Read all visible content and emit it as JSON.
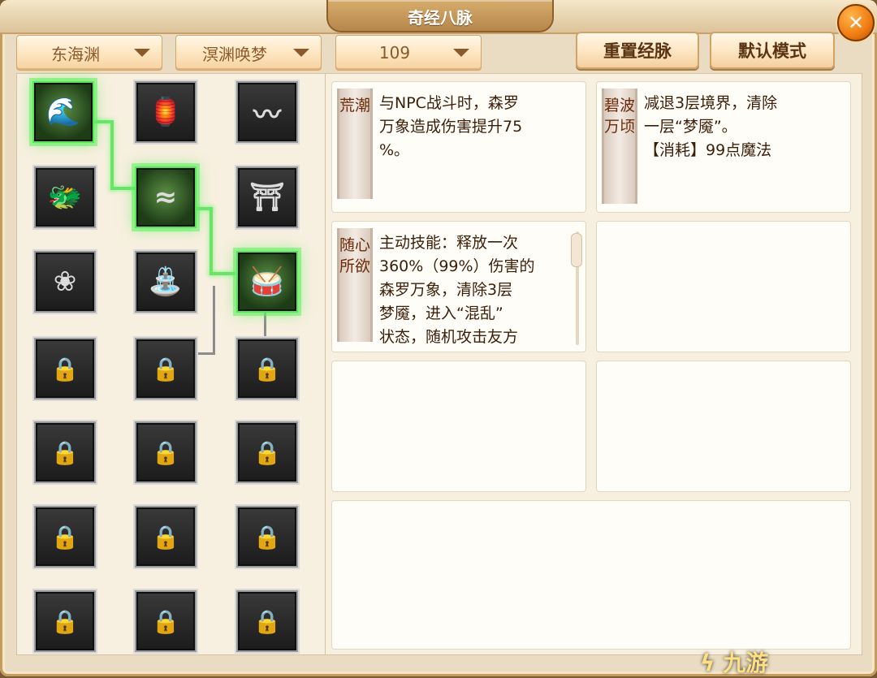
{
  "window": {
    "title": "奇经八脉",
    "close_label": "✕"
  },
  "filters": [
    {
      "id": "school",
      "value": "东海渊"
    },
    {
      "id": "path",
      "value": "溟渊唤梦"
    },
    {
      "id": "level",
      "value": "109"
    }
  ],
  "buttons": {
    "reset": "重置经脉",
    "default": "默认模式"
  },
  "cards": [
    {
      "tag": "荒潮",
      "text": "与NPC战斗时，森罗\n万象造成伤害提升75\n%。"
    },
    {
      "tag": "碧波万顷",
      "text": "减退3层境界，清除\n一层“梦魇”。\n【消耗】99点魔法"
    },
    {
      "tag": "随心所欲",
      "text": "主动技能：释放一次\n360%（99%）伤害的\n森罗万象，清除3层\n梦魇，进入“混乱”\n状态，随机攻击友方"
    }
  ],
  "icons": [
    {
      "row": 1,
      "col": 1,
      "name": "wave-spirit-icon",
      "glyph": "🌊",
      "active": true
    },
    {
      "row": 1,
      "col": 2,
      "name": "lantern-figure-icon",
      "glyph": "🏮",
      "active": false
    },
    {
      "row": 1,
      "col": 3,
      "name": "river-path-icon",
      "glyph": "〰",
      "active": false
    },
    {
      "row": 2,
      "col": 1,
      "name": "roaring-beast-icon",
      "glyph": "🐲",
      "active": false
    },
    {
      "row": 2,
      "col": 2,
      "name": "tide-wave-icon",
      "glyph": "≈",
      "active": true
    },
    {
      "row": 2,
      "col": 3,
      "name": "sea-temple-icon",
      "glyph": "⛩",
      "active": false
    },
    {
      "row": 3,
      "col": 1,
      "name": "lotus-icon",
      "glyph": "❀",
      "active": false
    },
    {
      "row": 3,
      "col": 2,
      "name": "waterfall-gate-icon",
      "glyph": "⛲",
      "active": false
    },
    {
      "row": 3,
      "col": 3,
      "name": "drum-strike-icon",
      "glyph": "🥁",
      "active": true
    },
    {
      "row": 4,
      "col": 1,
      "name": "lock-chain-icon",
      "glyph": "🔒",
      "locked": true
    },
    {
      "row": 4,
      "col": 2,
      "name": "lock-chain-icon",
      "glyph": "🔒",
      "locked": true
    },
    {
      "row": 4,
      "col": 3,
      "name": "lock-chain-icon",
      "glyph": "🔒",
      "locked": true
    },
    {
      "row": 5,
      "col": 1,
      "name": "lock-chain-icon",
      "glyph": "🔒",
      "locked": true
    },
    {
      "row": 5,
      "col": 2,
      "name": "lock-chain-icon",
      "glyph": "🔒",
      "locked": true
    },
    {
      "row": 5,
      "col": 3,
      "name": "lock-chain-icon",
      "glyph": "🔒",
      "locked": true
    },
    {
      "row": 6,
      "col": 1,
      "name": "lock-chain-icon",
      "glyph": "🔒",
      "locked": true
    },
    {
      "row": 6,
      "col": 2,
      "name": "lock-chain-icon",
      "glyph": "🔒",
      "locked": true
    },
    {
      "row": 6,
      "col": 3,
      "name": "lock-chain-icon",
      "glyph": "🔒",
      "locked": true
    },
    {
      "row": 7,
      "col": 1,
      "name": "lock-chain-icon",
      "glyph": "🔒",
      "locked": true
    },
    {
      "row": 7,
      "col": 2,
      "name": "lock-chain-icon",
      "glyph": "🔒",
      "locked": true
    },
    {
      "row": 7,
      "col": 3,
      "name": "lock-chain-icon",
      "glyph": "🔒",
      "locked": true
    }
  ],
  "watermark": {
    "prefix": "ϟ",
    "name": "九游"
  }
}
